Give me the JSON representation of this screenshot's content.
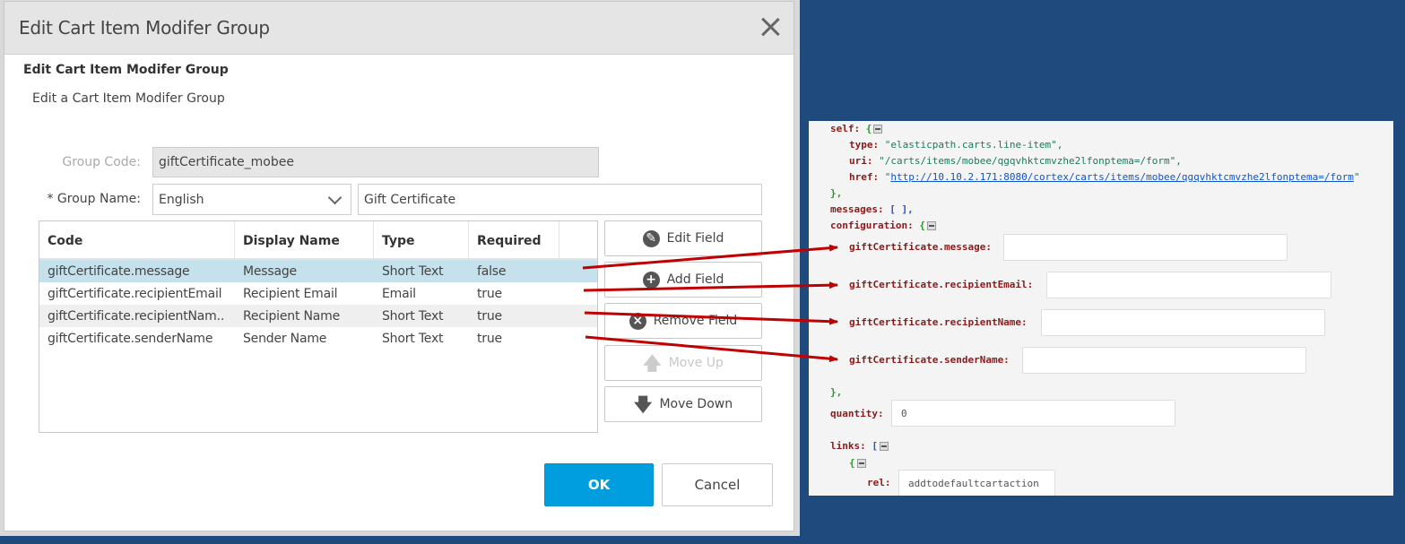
{
  "dialog": {
    "title": "Edit Cart Item Modifer Group",
    "close_icon": "close-icon",
    "subtitle": "Edit Cart Item Modifer Group",
    "description": "Edit a Cart Item Modifer Group",
    "group_code_label": "Group Code:",
    "group_code_value": "giftCertificate_mobee",
    "group_name_label": "* Group Name:",
    "language_selected": "English",
    "group_name_value": "Gift Certificate",
    "table": {
      "columns": [
        "Code",
        "Display Name",
        "Type",
        "Required",
        ""
      ],
      "rows": [
        {
          "code": "giftCertificate.message",
          "display_name": "Message",
          "type": "Short Text",
          "required": "false",
          "selected": true
        },
        {
          "code": "giftCertificate.recipientEmail",
          "display_name": "Recipient Email",
          "type": "Email",
          "required": "true"
        },
        {
          "code": "giftCertificate.recipientNam..",
          "display_name": "Recipient Name",
          "type": "Short Text",
          "required": "true"
        },
        {
          "code": "giftCertificate.senderName",
          "display_name": "Sender Name",
          "type": "Short Text",
          "required": "true"
        }
      ]
    },
    "buttons": {
      "edit_field": {
        "label": "Edit Field",
        "icon": "pencil-icon"
      },
      "add_field": {
        "label": "Add Field",
        "icon": "plus-circle-icon"
      },
      "remove_field": {
        "label": "Remove Field",
        "icon": "x-circle-icon"
      },
      "move_up": {
        "label": "Move Up",
        "icon": "arrow-up-icon",
        "disabled": true
      },
      "move_down": {
        "label": "Move Down",
        "icon": "arrow-down-icon"
      },
      "ok": "OK",
      "cancel": "Cancel"
    }
  },
  "json_view": {
    "self_key": "self:",
    "type_key": "type:",
    "type_val": "\"elasticpath.carts.line-item\",",
    "uri_key": "uri:",
    "uri_val": "\"/carts/items/mobee/qgqvhktcmvzhe2lfonptema=/form\",",
    "href_key": "href:",
    "href_val": "http://10.10.2.171:8080/cortex/carts/items/mobee/qgqvhktcmvzhe2lfonptema=/form",
    "messages_key": "messages:",
    "messages_val": "[ ],",
    "configuration_key": "configuration:",
    "config_fields": [
      {
        "key": "giftCertificate.message:",
        "value": ""
      },
      {
        "key": "giftCertificate.recipientEmail:",
        "value": ""
      },
      {
        "key": "giftCertificate.recipientName:",
        "value": ""
      },
      {
        "key": "giftCertificate.senderName:",
        "value": ""
      }
    ],
    "close_brace": "},",
    "quantity_key": "quantity:",
    "quantity_val": "0",
    "links_key": "links:",
    "rel_key": "rel:",
    "rel_val": "addtodefaultcartaction"
  },
  "annotation": {
    "arrow_color": "#c00000"
  }
}
